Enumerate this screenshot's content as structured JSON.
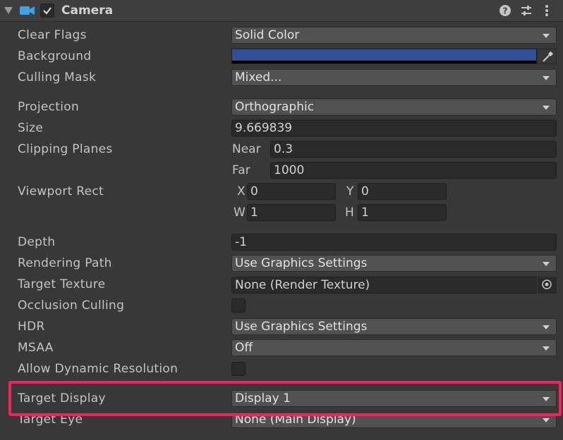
{
  "header": {
    "title": "Camera",
    "icons": [
      "foldout-triangle-icon",
      "camera-icon",
      "checkmark-icon",
      "help-icon",
      "presets-icon",
      "kebab-menu-icon"
    ]
  },
  "fields": {
    "clear_flags": {
      "label": "Clear Flags",
      "value": "Solid Color"
    },
    "background": {
      "label": "Background",
      "color": "#325095"
    },
    "culling_mask": {
      "label": "Culling Mask",
      "value": "Mixed..."
    },
    "projection": {
      "label": "Projection",
      "value": "Orthographic"
    },
    "size": {
      "label": "Size",
      "value": "9.669839"
    },
    "clipping_planes": {
      "label": "Clipping Planes",
      "near_label": "Near",
      "near": "0.3",
      "far_label": "Far",
      "far": "1000"
    },
    "viewport_rect": {
      "label": "Viewport Rect",
      "x_label": "X",
      "x": "0",
      "y_label": "Y",
      "y": "0",
      "w_label": "W",
      "w": "1",
      "h_label": "H",
      "h": "1"
    },
    "depth": {
      "label": "Depth",
      "value": "-1"
    },
    "rendering_path": {
      "label": "Rendering Path",
      "value": "Use Graphics Settings"
    },
    "target_texture": {
      "label": "Target Texture",
      "value": "None (Render Texture)"
    },
    "occlusion_culling": {
      "label": "Occlusion Culling",
      "checked": false
    },
    "hdr": {
      "label": "HDR",
      "value": "Use Graphics Settings"
    },
    "msaa": {
      "label": "MSAA",
      "value": "Off"
    },
    "allow_dynamic_resolution": {
      "label": "Allow Dynamic Resolution",
      "checked": false
    },
    "target_display": {
      "label": "Target Display",
      "value": "Display 1"
    },
    "target_eye": {
      "label": "Target Eye",
      "value": "None (Main Display)"
    }
  },
  "colors": {
    "highlight": "#f0245f",
    "background_swatch": "#325095"
  }
}
